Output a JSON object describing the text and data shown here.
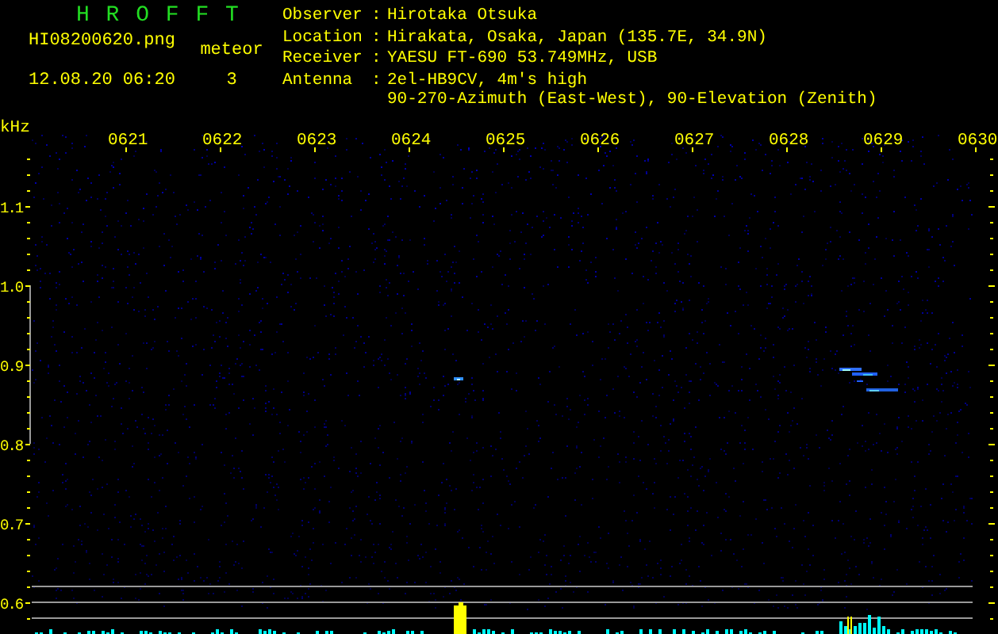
{
  "header": {
    "title": "H R O F F T",
    "filename": "HI08200620.png",
    "timestamp": "12.08.20 06:20",
    "count_label": "meteor",
    "count": "3"
  },
  "station": [
    {
      "label": "Observer",
      "lines": [
        "Hirotaka Otsuka"
      ]
    },
    {
      "label": "Location",
      "lines": [
        "Hirakata, Osaka, Japan (135.7E, 34.9N)"
      ]
    },
    {
      "label": "Receiver",
      "lines": [
        "YAESU FT-690 53.749MHz, USB"
      ]
    },
    {
      "label": "Antenna",
      "lines": [
        "2el-HB9CV, 4m's high",
        "90-270-Azimuth (East-West), 90-Elevation (Zenith)"
      ]
    }
  ],
  "spectrogram": {
    "unit": "kHz",
    "separator": ":",
    "time_labels": [
      "0621",
      "0622",
      "0623",
      "0624",
      "0625",
      "0626",
      "0627",
      "0628",
      "0629",
      "0630"
    ],
    "freq_labels": [
      "1.1",
      "1.0",
      "0.9",
      "0.8",
      "0.7",
      "0.6"
    ]
  }
}
